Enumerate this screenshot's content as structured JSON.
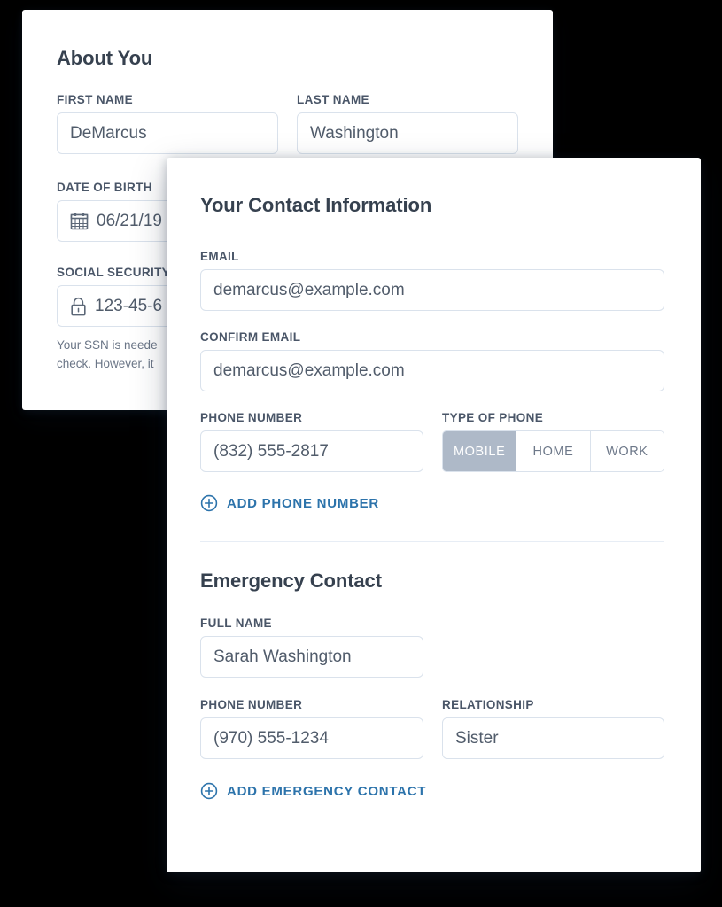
{
  "back_card": {
    "title": "About You",
    "fields": {
      "first_name": {
        "label": "FIRST NAME",
        "value": "DeMarcus"
      },
      "last_name": {
        "label": "LAST NAME",
        "value": "Washington"
      },
      "date_of_birth": {
        "label": "DATE OF BIRTH",
        "value": "06/21/19",
        "icon": "calendar-icon"
      },
      "ssn": {
        "label": "SOCIAL SECURITY",
        "value": "123-45-6",
        "icon": "lock-icon"
      }
    },
    "help_text_line1": "Your SSN is neede",
    "help_text_line2": "check. However, it"
  },
  "front_card": {
    "title": "Your Contact Information",
    "email": {
      "label": "EMAIL",
      "value": "demarcus@example.com"
    },
    "confirm_email": {
      "label": "CONFIRM EMAIL",
      "value": "demarcus@example.com"
    },
    "phone": {
      "label": "PHONE NUMBER",
      "value": "(832) 555-2817"
    },
    "phone_type": {
      "label": "TYPE OF PHONE",
      "options": [
        "MOBILE",
        "HOME",
        "WORK"
      ],
      "selected": "MOBILE"
    },
    "add_phone_link": "ADD PHONE NUMBER",
    "emergency": {
      "title": "Emergency Contact",
      "full_name": {
        "label": "FULL NAME",
        "value": "Sarah Washington"
      },
      "phone": {
        "label": "PHONE NUMBER",
        "value": "(970) 555-1234"
      },
      "relationship": {
        "label": "RELATIONSHIP",
        "value": "Sister"
      },
      "add_link": "ADD EMERGENCY CONTACT"
    }
  },
  "colors": {
    "heading": "#36414f",
    "label": "#4a5668",
    "input_text": "#515c6b",
    "input_border": "#dae2ec",
    "link_blue": "#2c73ab",
    "segment_active_bg": "#aeb9c8",
    "page_background": "#000000"
  }
}
